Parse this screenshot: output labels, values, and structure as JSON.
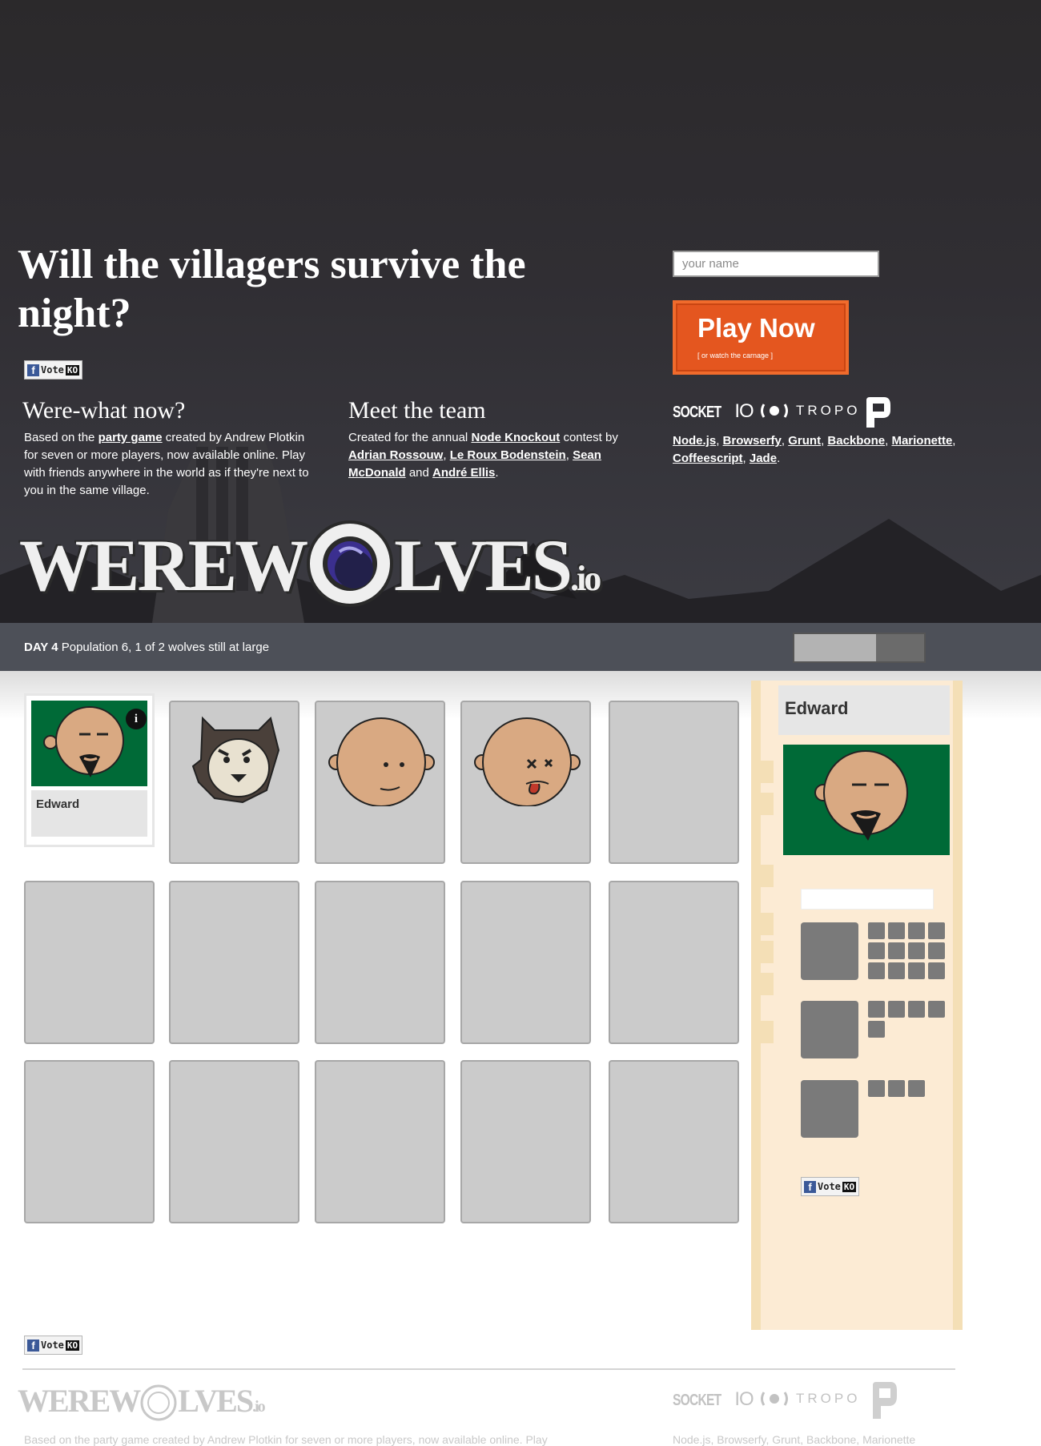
{
  "hero": {
    "headline": "Will the villagers survive the night?",
    "vote": {
      "v": "Vote",
      "ko": "KO"
    },
    "about_title": "Were-what now?",
    "about_text_1": "Based on the ",
    "about_link": "party game",
    "about_text_2": " created by Andrew Plotkin for seven or more players, now available online. Play with friends anywhere in the world as if they're next to you in the same village.",
    "team_title": "Meet the team",
    "team_text_1": "Created for the annual ",
    "team_link_contest": "Node Knockout",
    "team_text_2": " contest by ",
    "team_member_1": "Adrian Rossouw",
    "team_member_2": "Le Roux Bodenstein",
    "team_member_3": "Sean McDonald",
    "team_and": " and ",
    "team_member_4": "André Ellis",
    "team_end": ".",
    "name_placeholder": "your name",
    "play_label": "Play Now",
    "play_sub": "[ or watch the carnage ]",
    "socket_logo_a": "SOCKET",
    "socket_logo_b": "IO",
    "tropo_logo": "TROPO",
    "tech": [
      "Node.js",
      "Browserfy",
      "Grunt",
      "Backbone",
      "Marionette",
      "Coffeescript",
      "Jade"
    ],
    "logo_text_1": "WEREW",
    "logo_text_2": "LVES",
    "logo_text_3": ".io"
  },
  "status": {
    "day": "DAY 4",
    "text": "Population 6, 1 of 2 wolves still at large",
    "timer_fraction": 0.63
  },
  "players": {
    "selected_name": "Edward"
  },
  "side_panel": {
    "name": "Edward"
  },
  "footer": {
    "logo_text_1": "WEREW",
    "logo_text_2": "LVES",
    "logo_text_3": ".io",
    "about_text": "Based on the party game created by Andrew Plotkin for seven or more players, now available online. Play",
    "tech_text": "Node.js, Browserfy, Grunt, Backbone, Marionette"
  },
  "colors": {
    "accent_orange": "#e4561f",
    "player_bg_green": "#006a37",
    "panel_bg": "#fcebd4"
  }
}
